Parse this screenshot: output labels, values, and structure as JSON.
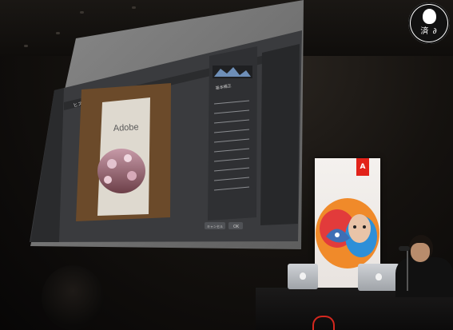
{
  "screen": {
    "toolbar_title": "ヒストグラム",
    "panel_title": "基本補正",
    "buttons": {
      "cancel": "キャンセル",
      "ok": "OK"
    },
    "photo_sign": "Adobe"
  },
  "badge": {
    "text": "済 ∂"
  },
  "banner": {
    "brand": "A"
  },
  "colors": {
    "adobe_red": "#e2231a",
    "screen_ui": "#3b3d40",
    "screen_bg": "#2c2d2f"
  }
}
